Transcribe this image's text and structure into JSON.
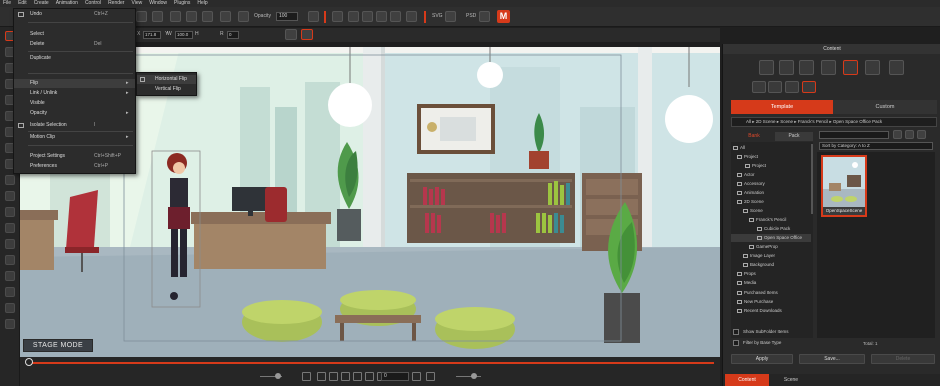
{
  "menubar": [
    "File",
    "Edit",
    "Create",
    "Animation",
    "Control",
    "Render",
    "View",
    "Window",
    "Plugins",
    "Help"
  ],
  "toolbar": {
    "opacity_label": "Opacity",
    "opacity_value": "100",
    "svg_label": "SVG",
    "psd_label": "PSD",
    "m_label": "M"
  },
  "transform": {
    "x_label": "X",
    "x_value": "171.8",
    "y_label": "Y",
    "y_value": "-76.1",
    "w_label": "W",
    "w_value": "100.0",
    "h_label": "H",
    "h_value": "100.0",
    "r_label": "R",
    "r_value": "0"
  },
  "context_menu": {
    "items": [
      {
        "label": "Undo",
        "shortcut": "Ctrl+Z"
      },
      {
        "label": "Select",
        "shortcut": ""
      },
      {
        "label": "Delete",
        "shortcut": "Del"
      },
      {
        "label": "Duplicate",
        "shortcut": ""
      },
      {
        "label": "Flip",
        "shortcut": ""
      },
      {
        "label": "Link / Unlink",
        "shortcut": ""
      },
      {
        "label": "Visible",
        "shortcut": ""
      },
      {
        "label": "Opacity",
        "shortcut": ""
      },
      {
        "label": "Isolate Selection",
        "shortcut": "I"
      },
      {
        "label": "Motion Clip",
        "shortcut": ""
      },
      {
        "label": "Project Settings",
        "shortcut": "Ctrl+Shift+P"
      },
      {
        "label": "Preferences",
        "shortcut": "Ctrl+P"
      }
    ]
  },
  "flip_submenu": [
    "Horizontal Flip",
    "Vertical Flip"
  ],
  "stage": {
    "mode_label": "STAGE MODE"
  },
  "timeline": {
    "frame_value": "0"
  },
  "content_panel": {
    "title": "Content",
    "tabs": [
      "Template",
      "Custom"
    ],
    "breadcrumb": "All  ▸  2D Scene  ▸  Scene  ▸  Franck's Pencil  ▸  Open Space Office Pack",
    "sub_tabs": [
      "Bank",
      "Pack"
    ],
    "sort_label": "Sort by Category: A to Z",
    "tree": [
      {
        "label": "All",
        "depth": 0
      },
      {
        "label": "Project",
        "depth": 1
      },
      {
        "label": "Project",
        "depth": 2
      },
      {
        "label": "Actor",
        "depth": 1
      },
      {
        "label": "Accessory",
        "depth": 1
      },
      {
        "label": "Animation",
        "depth": 1
      },
      {
        "label": "2D Scene",
        "depth": 1
      },
      {
        "label": "Scene",
        "depth": 2
      },
      {
        "label": "Franck's Pencil",
        "depth": 3
      },
      {
        "label": "Cubicle Pack",
        "depth": 4
      },
      {
        "label": "Open Space Office",
        "depth": 4
      },
      {
        "label": "GameProp",
        "depth": 3
      },
      {
        "label": "Image Layer",
        "depth": 2
      },
      {
        "label": "Background",
        "depth": 2
      },
      {
        "label": "Props",
        "depth": 1
      },
      {
        "label": "Media",
        "depth": 1
      },
      {
        "label": "Purchased Items",
        "depth": 1
      },
      {
        "label": "New Purchase",
        "depth": 1
      },
      {
        "label": "Recent Downloads",
        "depth": 1
      }
    ],
    "thumbnail_label": "OpenSpaceScene",
    "total_label": "Total: 1",
    "checkboxes": [
      "Show SubFolder Items",
      "Filter by Base Type"
    ],
    "buttons": [
      "Apply",
      "Save...",
      "Delete"
    ],
    "bottom_tabs": [
      "Content",
      "Scene"
    ]
  },
  "colors": {
    "accent": "#d63a1a"
  }
}
